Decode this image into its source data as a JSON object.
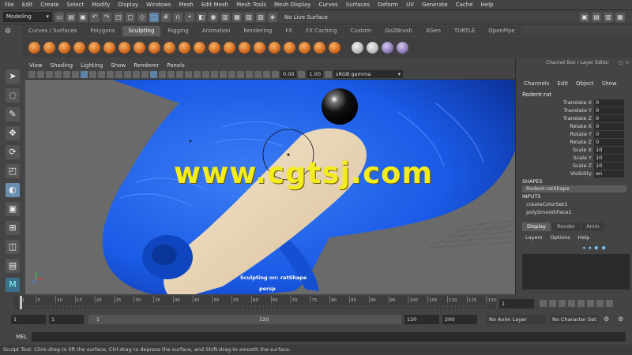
{
  "menubar": [
    "File",
    "Edit",
    "Create",
    "Select",
    "Modify",
    "Display",
    "Windows",
    "Mesh",
    "Edit Mesh",
    "Mesh Tools",
    "Mesh Display",
    "Curves",
    "Surfaces",
    "Deform",
    "UV",
    "Generate",
    "Cache",
    "Help"
  ],
  "statusline": {
    "mode": "Modeling",
    "live_surface": "No Live Surface"
  },
  "shelf_tabs": [
    "Curves / Surfaces",
    "Polygons",
    "Sculpting",
    "Rigging",
    "Animation",
    "Rendering",
    "FX",
    "FX Caching",
    "Custom",
    "GoZBrush",
    "XGen",
    "TURTLE",
    "OpenPipe"
  ],
  "shelf_active": "Sculpting",
  "panel_menu": [
    "View",
    "Shading",
    "Lighting",
    "Show",
    "Renderer",
    "Panels"
  ],
  "panel_toolbar": {
    "exposure": "0.00",
    "gamma_value": "1.00",
    "color_space": "sRGB gamma"
  },
  "viewport": {
    "watermark": "www.cgtsj.com",
    "hud_sculpt": "Sculpting on: ratShape",
    "camera": "persp",
    "colors": {
      "body": "#1a5ae6",
      "highlight": "#efdcc0",
      "background": "#6a6a6a"
    }
  },
  "channel_box": {
    "title": "Channel Box / Layer Editor",
    "menu": [
      "Channels",
      "Edit",
      "Object",
      "Show"
    ],
    "object": "Rodent:rat",
    "attributes": [
      {
        "label": "Translate X",
        "value": "0"
      },
      {
        "label": "Translate Y",
        "value": "0"
      },
      {
        "label": "Translate Z",
        "value": "0"
      },
      {
        "label": "Rotate X",
        "value": "0"
      },
      {
        "label": "Rotate Y",
        "value": "0"
      },
      {
        "label": "Rotate Z",
        "value": "0"
      },
      {
        "label": "Scale X",
        "value": "10"
      },
      {
        "label": "Scale Y",
        "value": "10"
      },
      {
        "label": "Scale Z",
        "value": "10"
      },
      {
        "label": "Visibility",
        "value": "on"
      }
    ],
    "shapes_header": "SHAPES",
    "shape": "Rodent:ratShape",
    "inputs_header": "INPUTS",
    "inputs": [
      "createColorSet1",
      "polySmoothFace1"
    ],
    "display_tabs": [
      "Display",
      "Render",
      "Anim"
    ],
    "layer_menu": [
      "Layers",
      "Options",
      "Help"
    ]
  },
  "timeline": {
    "ticks": [
      "1",
      "5",
      "10",
      "15",
      "20",
      "25",
      "30",
      "35",
      "40",
      "45",
      "50",
      "55",
      "60",
      "65",
      "70",
      "75",
      "80",
      "85",
      "90",
      "95",
      "100",
      "105",
      "110",
      "115",
      "120"
    ],
    "current_frame": "1"
  },
  "range": {
    "start": "1",
    "inner_start": "1",
    "slider_start": "1",
    "slider_end": "120",
    "inner_end": "120",
    "end": "200",
    "anim_layer": "No Anim Layer",
    "character_set": "No Character Set"
  },
  "mel_label": "MEL",
  "help_line": "Sculpt Tool: Click-drag to lift the surface, Ctrl-drag to depress the surface, and Shift-drag to smooth the surface."
}
